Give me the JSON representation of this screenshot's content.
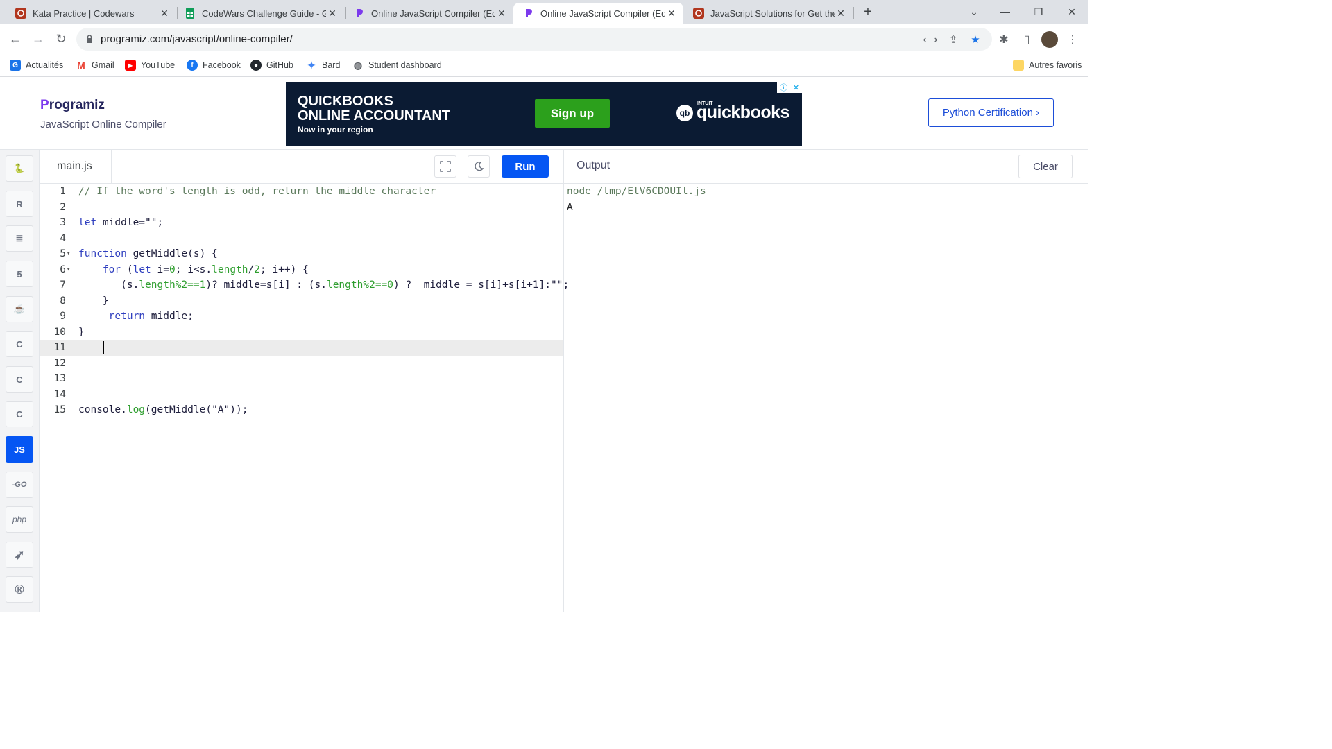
{
  "browser": {
    "tabs": [
      {
        "title": "Kata Practice | Codewars",
        "active": false
      },
      {
        "title": "CodeWars Challenge Guide - Goo",
        "active": false
      },
      {
        "title": "Online JavaScript Compiler (Edito",
        "active": false
      },
      {
        "title": "Online JavaScript Compiler (Edito",
        "active": true
      },
      {
        "title": "JavaScript Solutions for Get the M",
        "active": false
      }
    ],
    "url": "programiz.com/javascript/online-compiler/",
    "bookmarks": [
      {
        "label": "Actualités"
      },
      {
        "label": "Gmail"
      },
      {
        "label": "YouTube"
      },
      {
        "label": "Facebook"
      },
      {
        "label": "GitHub"
      },
      {
        "label": "Bard"
      },
      {
        "label": "Student dashboard"
      }
    ],
    "other_bookmarks": "Autres favoris"
  },
  "site": {
    "logo_p": "P",
    "logo_rest": "rogramiz",
    "subtitle": "JavaScript Online Compiler",
    "ad": {
      "line1": "QUICKBOOKS",
      "line2": "ONLINE ACCOUNTANT",
      "tagline": "Now in your region",
      "cta": "Sign up",
      "brand_small": "INTUIT",
      "brand": "quickbooks",
      "brand_badge": "qb"
    },
    "cert_button": "Python Certification ›"
  },
  "sidebar": {
    "languages": [
      {
        "name": "python",
        "glyph": "🐍",
        "active": false
      },
      {
        "name": "r",
        "glyph": "R",
        "active": false
      },
      {
        "name": "sql",
        "glyph": "≣",
        "active": false
      },
      {
        "name": "html",
        "glyph": "5",
        "active": false
      },
      {
        "name": "java",
        "glyph": "☕",
        "active": false
      },
      {
        "name": "c",
        "glyph": "C",
        "active": false
      },
      {
        "name": "cpp",
        "glyph": "C",
        "active": false
      },
      {
        "name": "csharp",
        "glyph": "C",
        "active": false
      },
      {
        "name": "javascript",
        "glyph": "JS",
        "active": true
      },
      {
        "name": "go",
        "glyph": "-GO",
        "active": false
      },
      {
        "name": "php",
        "glyph": "php",
        "active": false
      },
      {
        "name": "swift",
        "glyph": "➶",
        "active": false
      },
      {
        "name": "rust",
        "glyph": "®",
        "active": false
      }
    ]
  },
  "editor": {
    "filename": "main.js",
    "run_label": "Run",
    "current_line": 11,
    "lines": [
      {
        "n": "1",
        "fold": ""
      },
      {
        "n": "2",
        "fold": ""
      },
      {
        "n": "3",
        "fold": ""
      },
      {
        "n": "4",
        "fold": ""
      },
      {
        "n": "5",
        "fold": "▾"
      },
      {
        "n": "6",
        "fold": "▾"
      },
      {
        "n": "7",
        "fold": ""
      },
      {
        "n": "8",
        "fold": ""
      },
      {
        "n": "9",
        "fold": ""
      },
      {
        "n": "10",
        "fold": ""
      },
      {
        "n": "11",
        "fold": ""
      },
      {
        "n": "12",
        "fold": ""
      },
      {
        "n": "13",
        "fold": ""
      },
      {
        "n": "14",
        "fold": ""
      },
      {
        "n": "15",
        "fold": ""
      }
    ],
    "code": {
      "l1": "// If the word's length is odd, return the middle character",
      "l3_kw": "let",
      "l3_rest": " middle=\"\";",
      "l5_kw": "function",
      "l5_rest": " getMiddle(s) {",
      "l6_indent": "    ",
      "l6_kw1": "for",
      "l6_a": " (",
      "l6_kw2": "let",
      "l6_b": " i=",
      "l6_n1": "0",
      "l6_c": "; i<s.",
      "l6_p1": "length",
      "l6_d": "/",
      "l6_n2": "2",
      "l6_e": "; i++) {",
      "l7_a": "       (s.",
      "l7_p1": "length",
      "l7_n1": "%2==1",
      "l7_b": ")? middle=s[i] : (s.",
      "l7_p2": "length",
      "l7_n2": "%2==0",
      "l7_c": ") ?  middle = s[i]+s[i+1]:\"\";",
      "l8": "    }",
      "l9_indent": "     ",
      "l9_kw": "return",
      "l9_rest": " middle;",
      "l10": "}",
      "l15_a": "console.",
      "l15_p": "log",
      "l15_b": "(getMiddle(\"A\"));"
    }
  },
  "output": {
    "title": "Output",
    "clear_label": "Clear",
    "command": "node /tmp/EtV6CDOUIl.js",
    "result": "A"
  }
}
